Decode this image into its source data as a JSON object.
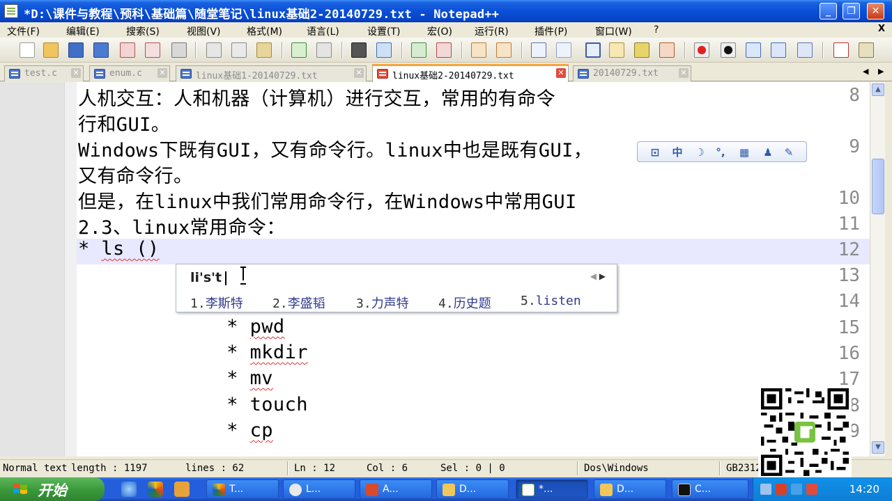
{
  "window": {
    "title": "*D:\\课件与教程\\预科\\基础篇\\随堂笔记\\linux基础2-20140729.txt - Notepad++"
  },
  "menu": [
    "文件(F)",
    "编辑(E)",
    "搜索(S)",
    "视图(V)",
    "格式(M)",
    "语言(L)",
    "设置(T)",
    "宏(O)",
    "运行(R)",
    "插件(P)",
    "窗口(W)",
    "?"
  ],
  "menu_close": "X",
  "tabs": [
    {
      "label": "test.c"
    },
    {
      "label": "enum.c"
    },
    {
      "label": "linux基础1-20140729.txt"
    },
    {
      "label": "linux基础2-20140729.txt"
    },
    {
      "label": "20140729.txt"
    }
  ],
  "editor": {
    "lines": [
      {
        "num": "8",
        "text": "人机交互：人和机器（计算机）进行交互，常用的有命令"
      },
      {
        "num": "",
        "text": "行和GUI。"
      },
      {
        "num": "9",
        "text": "Windows下既有GUI，又有命令行。linux中也是既有GUI，"
      },
      {
        "num": "",
        "text": "又有命令行。"
      },
      {
        "num": "10",
        "text": "但是，在linux中我们常用命令行，在Windows中常用GUI"
      },
      {
        "num": "11",
        "text": "2.3、linux常用命令："
      },
      {
        "num": "12",
        "text_prefix": "* ",
        "text_squig": "ls ()"
      },
      {
        "num": "13",
        "text": ""
      },
      {
        "num": "14",
        "text": ""
      },
      {
        "num": "15",
        "text_prefix": "  * ",
        "text_squig": "pwd"
      },
      {
        "num": "16",
        "text_prefix": "  * ",
        "text_squig": "mkdir"
      },
      {
        "num": "17",
        "text_prefix": "  * ",
        "text_squig": "mv"
      },
      {
        "num": "18",
        "text_prefix": "  * ",
        "text": "touch"
      },
      {
        "num": "19",
        "text_prefix": "  * ",
        "text_squig": "cp"
      }
    ]
  },
  "ime": {
    "composition": "li's't",
    "candidates": [
      {
        "num": "1.",
        "text": "李斯特"
      },
      {
        "num": "2.",
        "text": "李盛韬"
      },
      {
        "num": "3.",
        "text": "力声特"
      },
      {
        "num": "4.",
        "text": "历史题"
      },
      {
        "num": "5.",
        "text": "listen"
      }
    ],
    "toolbar_mode": "中"
  },
  "status": {
    "type": "Normal text file",
    "length": "length : 1197",
    "lines": "lines : 62",
    "ln": "Ln : 12",
    "col": "Col : 6",
    "sel": "Sel : 0 | 0",
    "eol": "Dos\\Windows",
    "encoding": "GB2312"
  },
  "taskbar": {
    "start": "开始",
    "tasks": [
      {
        "label": "T..."
      },
      {
        "label": "L..."
      },
      {
        "label": "A..."
      },
      {
        "label": "D..."
      },
      {
        "label": "*..."
      },
      {
        "label": "D..."
      },
      {
        "label": "C..."
      }
    ],
    "clock": "14:20"
  },
  "colors": {
    "accent": "#245edb",
    "tab_active": "#f5a43b",
    "current_line": "#e8e8ff"
  }
}
